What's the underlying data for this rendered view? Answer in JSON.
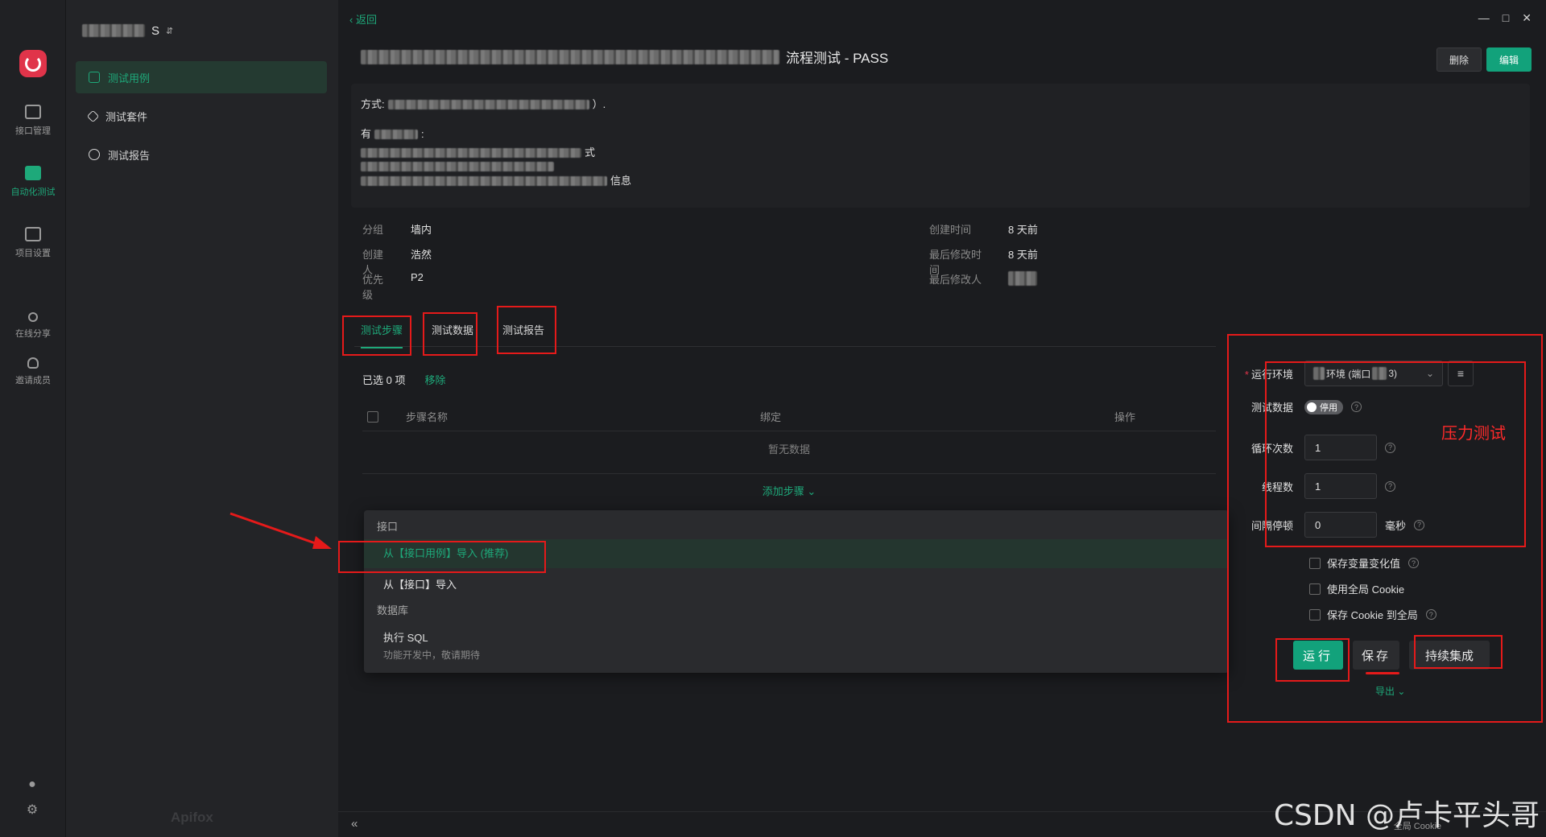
{
  "rail": {
    "items": [
      {
        "label": "接口管理"
      },
      {
        "label": "自动化测试"
      },
      {
        "label": "项目设置"
      },
      {
        "label": "在线分享"
      },
      {
        "label": "邀请成员"
      }
    ]
  },
  "sidebar": {
    "project_suffix": "S",
    "items": [
      {
        "label": "测试用例"
      },
      {
        "label": "测试套件"
      },
      {
        "label": "测试报告"
      }
    ],
    "brand": "Apifox"
  },
  "header": {
    "back": "返回",
    "title": "流程测试 - PASS",
    "delete": "删除",
    "edit": "编辑"
  },
  "description": {
    "line1_prefix": "方式:",
    "line1_suffix": "）.",
    "line2_prefix": "有",
    "line2_suffix": ":",
    "line3_suffix": "式",
    "line5_suffix": "信息"
  },
  "meta": {
    "group_label": "分组",
    "group_value": "墙内",
    "creator_label": "创建人",
    "creator_value": "浩然",
    "priority_label": "优先级",
    "priority_value": "P2",
    "created_label": "创建时间",
    "created_value": "8 天前",
    "modified_label": "最后修改时间",
    "modified_value": "8 天前",
    "modifier_label": "最后修改人"
  },
  "tabs": [
    "测试步骤",
    "测试数据",
    "测试报告"
  ],
  "selection": {
    "count_text": "已选 0 项",
    "remove": "移除"
  },
  "table": {
    "headers": [
      "步骤名称",
      "绑定",
      "操作"
    ],
    "empty": "暂无数据",
    "add_step": "添加步骤 ⌄"
  },
  "dropdown": {
    "group1": "接口",
    "item1": "从【接口用例】导入 (推荐)",
    "item2": "从【接口】导入",
    "group2": "数据库",
    "item3": "执行 SQL",
    "item3_sub": "功能开发中，敬请期待"
  },
  "run_panel": {
    "env_label": "运行环境",
    "env_value": "环境 (端口",
    "env_value_tail": "3)",
    "test_data_label": "测试数据",
    "test_data_toggle": "停用",
    "loop_label": "循环次数",
    "loop_value": "1",
    "thread_label": "线程数",
    "thread_value": "1",
    "interval_label": "间隔停顿",
    "interval_value": "0",
    "interval_unit": "毫秒",
    "check1": "保存变量变化值",
    "check2": "使用全局 Cookie",
    "check3": "保存 Cookie 到全局",
    "run": "运行",
    "save": "保存",
    "ci": "持续集成",
    "export": "导出 ⌄"
  },
  "bottom": {
    "global_cookie": "全局 Cookie"
  },
  "annotation": {
    "pressure": "压力测试"
  },
  "watermark": "CSDN @卢卡平头哥",
  "colors": {
    "accent": "#1ea97a",
    "annotation": "#e51a1a",
    "brand": "#e0344a"
  }
}
